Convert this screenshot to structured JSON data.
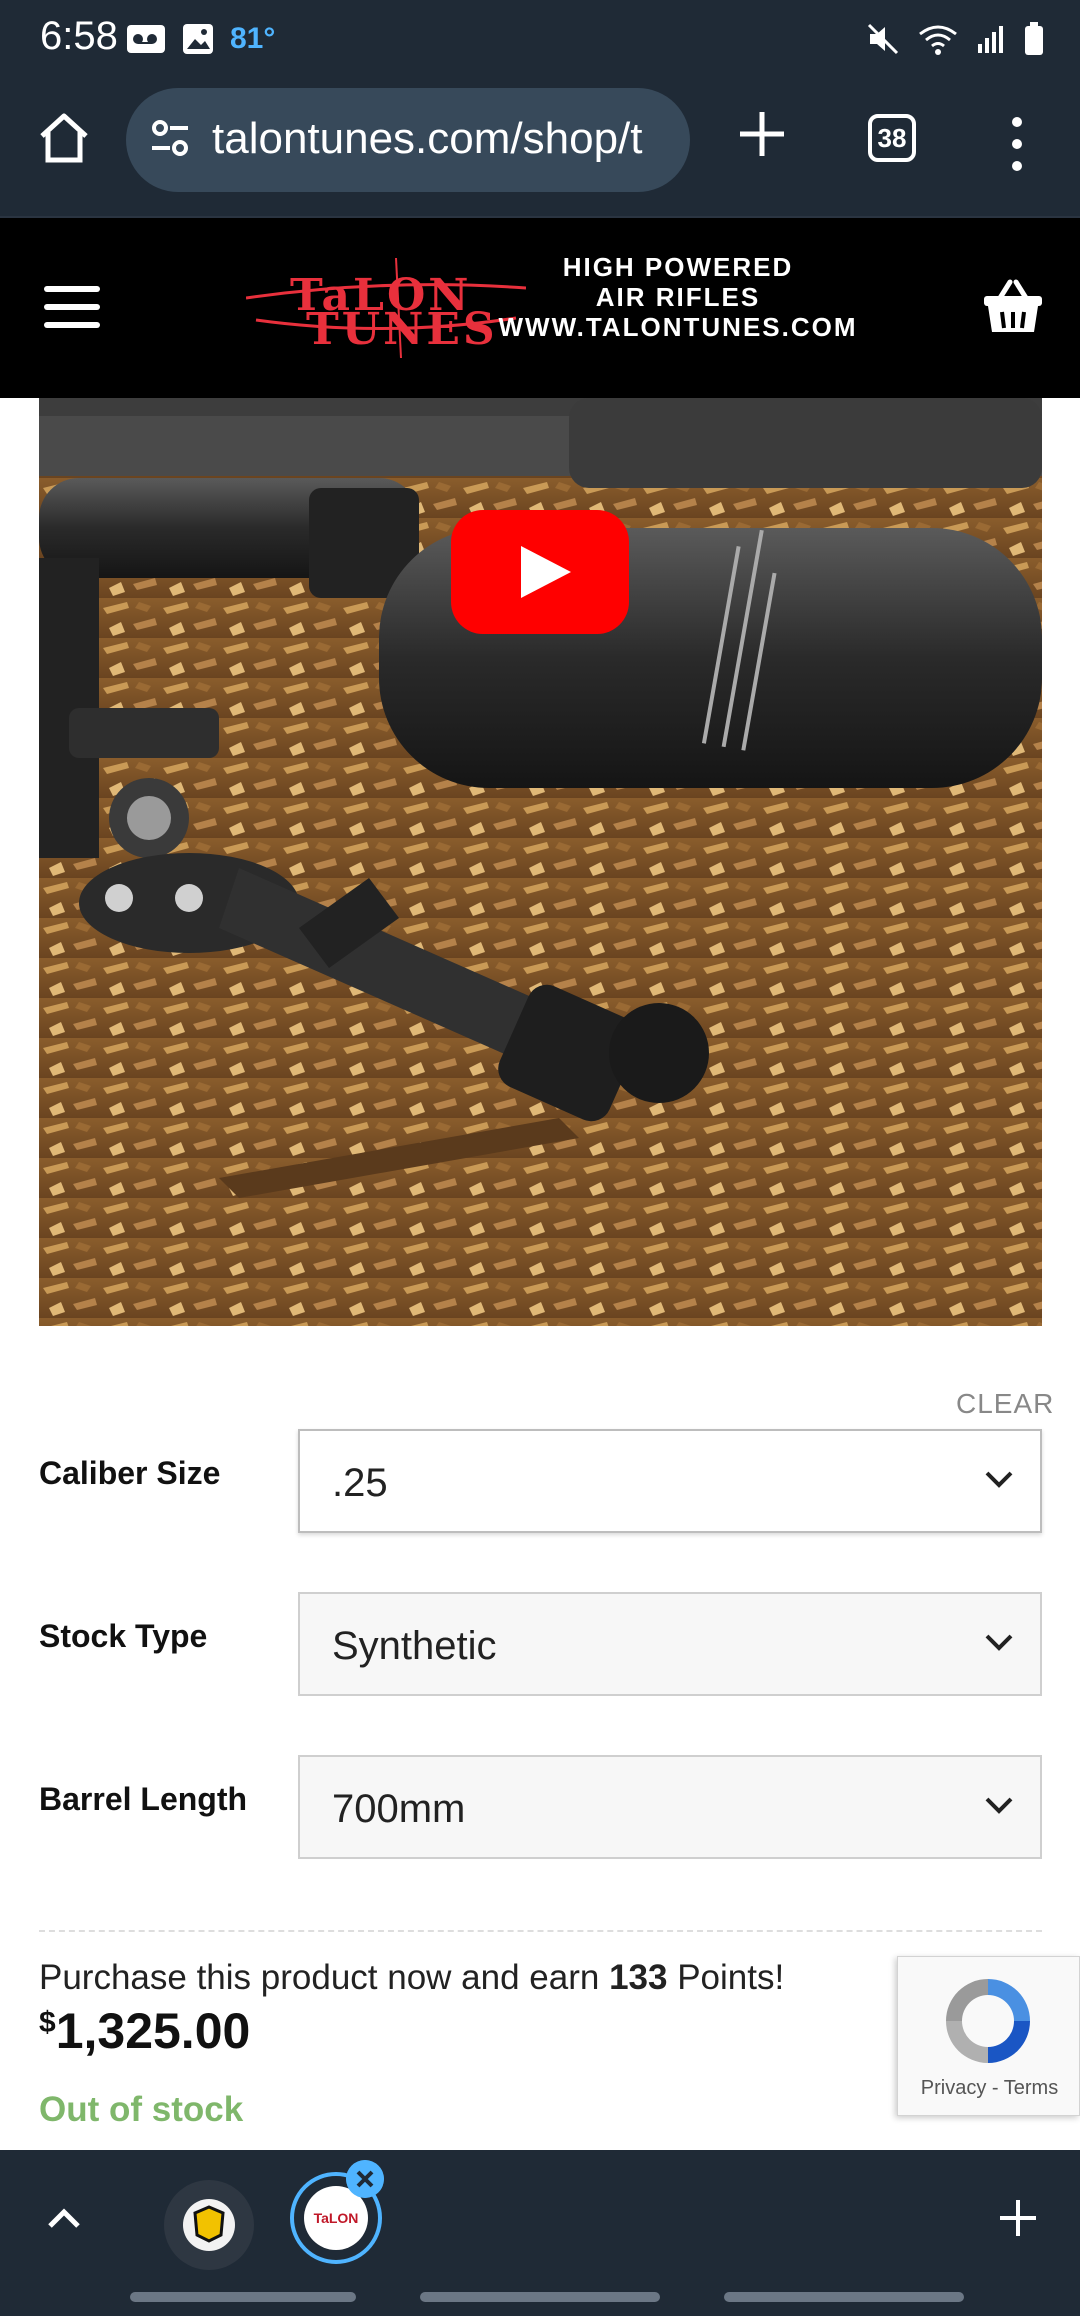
{
  "status_bar": {
    "time": "6:58",
    "temperature": "81°",
    "temperature_color": "#4fb4ff"
  },
  "browser": {
    "url": "talontunes.com/shop/t",
    "tab_count": "38",
    "background_color": "#1f2a36"
  },
  "site_header": {
    "logo_brand_line1": "TaLON",
    "logo_brand_line2": "TUNES",
    "logo_tagline_line1": "HIGH POWERED",
    "logo_tagline_line2": "AIR RIFLES",
    "logo_tagline_line3": "WWW.TALONTUNES.COM",
    "brand_color": "#e8303c"
  },
  "product_media": {
    "video_play_icon": "youtube-play-icon"
  },
  "variations": {
    "clear_label": "CLEAR",
    "rows": [
      {
        "label": "Caliber Size",
        "value": ".25"
      },
      {
        "label": "Stock Type",
        "value": "Synthetic"
      },
      {
        "label": "Barrel Length",
        "value": "700mm"
      }
    ]
  },
  "purchase": {
    "points_prefix": "Purchase this product now and earn ",
    "points_value": "133",
    "points_suffix": " Points!",
    "currency_symbol": "$",
    "price": "1,325.00",
    "stock_status": "Out of stock",
    "stock_color": "#7fb76b"
  },
  "recaptcha": {
    "privacy": "Privacy",
    "separator": " - ",
    "terms": "Terms"
  },
  "bottom_bar": {
    "second_tab_label": "TaLON"
  }
}
